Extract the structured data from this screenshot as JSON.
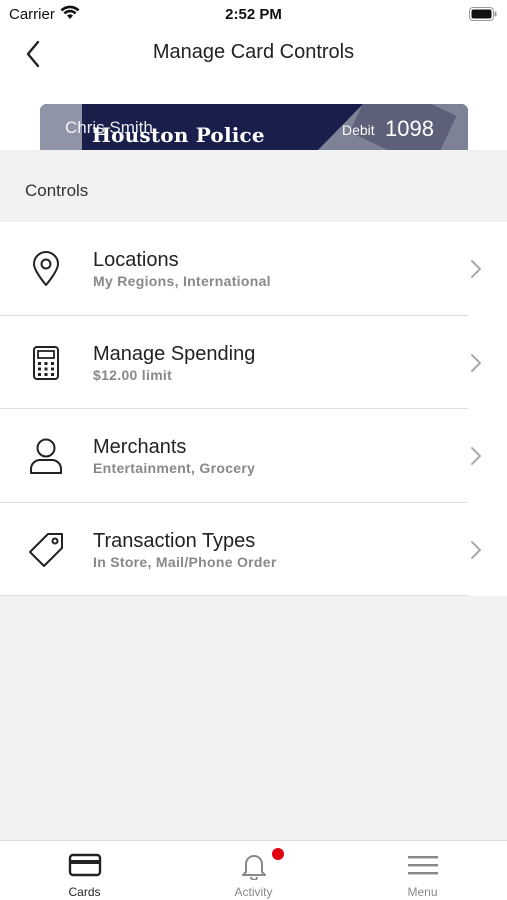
{
  "status_bar": {
    "carrier": "Carrier",
    "time": "2:52 PM"
  },
  "nav": {
    "title": "Manage Card Controls",
    "back_icon": "chevron-left-icon"
  },
  "card": {
    "bank_name": "Houston Police",
    "holder": "Chris Smith",
    "type": "Debit",
    "last_four": "1098",
    "color": "#1a1e4a"
  },
  "section": {
    "title": "Controls"
  },
  "controls": [
    {
      "icon": "location-pin-icon",
      "title": "Locations",
      "subtitle": "My Regions, International"
    },
    {
      "icon": "calculator-icon",
      "title": "Manage Spending",
      "subtitle": "$12.00 limit"
    },
    {
      "icon": "person-icon",
      "title": "Merchants",
      "subtitle": "Entertainment, Grocery"
    },
    {
      "icon": "tag-icon",
      "title": "Transaction Types",
      "subtitle": "In Store, Mail/Phone Order"
    }
  ],
  "tabs": [
    {
      "icon": "card-icon",
      "label": "Cards",
      "active": true
    },
    {
      "icon": "bell-icon",
      "label": "Activity",
      "active": false
    },
    {
      "icon": "menu-icon",
      "label": "Menu",
      "active": false
    }
  ],
  "colors": {
    "badge": "#e1000f",
    "background": "#f2f2f2"
  }
}
